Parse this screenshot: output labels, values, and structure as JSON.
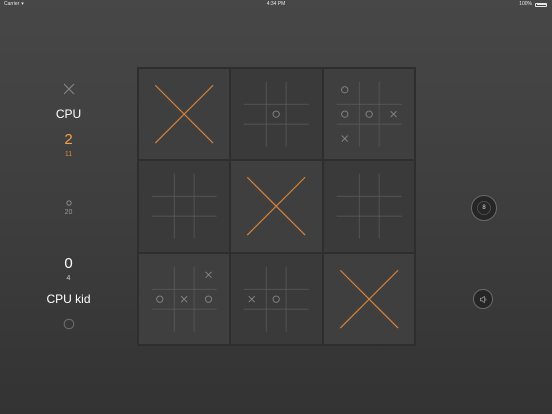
{
  "status_bar": {
    "carrier": "Carrier",
    "time": "4:34 PM",
    "battery": "100%"
  },
  "players": {
    "top": {
      "name": "CPU",
      "mark": "x-icon",
      "score": "2",
      "sub": "11"
    },
    "draws": {
      "mark": "o-icon",
      "sub": "20"
    },
    "bottom": {
      "name": "CPU kid",
      "mark": "o-icon",
      "score": "0",
      "sub": "4"
    }
  },
  "board": {
    "cells": [
      {
        "state": "won",
        "winner": "X",
        "mini": []
      },
      {
        "state": "active",
        "winner": "",
        "mini": [
          "",
          "",
          "",
          "",
          "O",
          "",
          "",
          "",
          ""
        ]
      },
      {
        "state": "active",
        "winner": "",
        "mini": [
          "O",
          "",
          "",
          "O",
          "O",
          "X",
          "X",
          "",
          ""
        ]
      },
      {
        "state": "active",
        "winner": "",
        "mini": [
          "",
          "",
          "",
          "",
          "",
          "",
          "",
          "",
          ""
        ]
      },
      {
        "state": "won",
        "winner": "X",
        "mini": []
      },
      {
        "state": "active",
        "winner": "",
        "mini": [
          "",
          "",
          "",
          "",
          "",
          "",
          "",
          "",
          ""
        ]
      },
      {
        "state": "active",
        "winner": "",
        "mini": [
          "",
          "",
          "X",
          "O",
          "X",
          "O",
          "",
          "",
          ""
        ]
      },
      {
        "state": "active",
        "winner": "",
        "mini": [
          "",
          "",
          "",
          "X",
          "O",
          "",
          "",
          "",
          ""
        ]
      },
      {
        "state": "won",
        "winner": "X",
        "mini": []
      }
    ]
  },
  "controls": {
    "timer_value": "8",
    "sound_icon": "speaker-icon"
  },
  "colors": {
    "accent": "#d9833a",
    "grid": "#5c5c5c",
    "mini_mark": "#8c8c8c"
  }
}
